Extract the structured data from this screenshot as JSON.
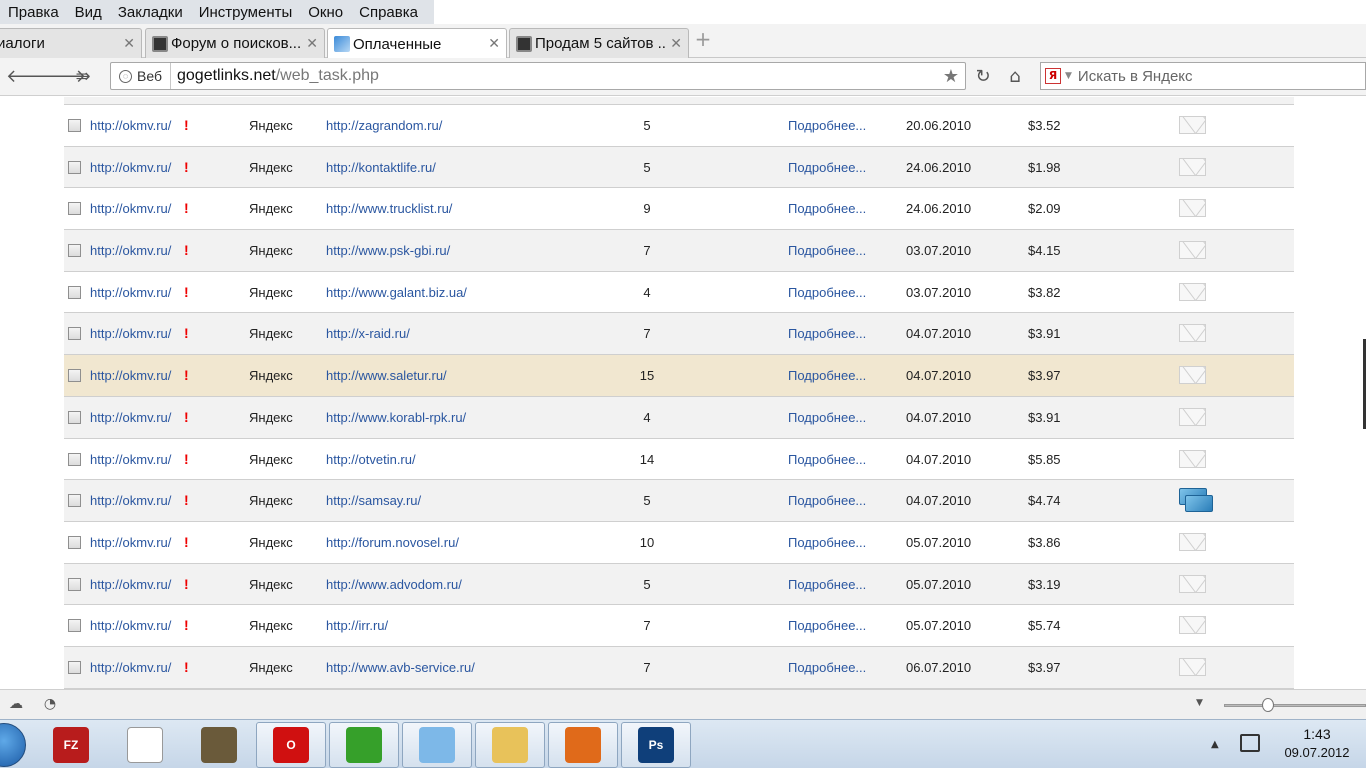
{
  "menu": [
    "Правка",
    "Вид",
    "Закладки",
    "Инструменты",
    "Окно",
    "Справка"
  ],
  "tabs": [
    {
      "title": "иалоги",
      "favicon": "none",
      "active": false
    },
    {
      "title": "Форум о поисков...",
      "favicon": "forum-icon",
      "active": false
    },
    {
      "title": "Оплаченные",
      "favicon": "chart-icon",
      "active": true
    },
    {
      "title": "Продам 5 сайтов ...",
      "favicon": "forum-icon",
      "active": false
    }
  ],
  "address": {
    "mode_label": "Веб",
    "host": "gogetlinks.net",
    "path": "/web_task.php"
  },
  "search": {
    "logo": "Я",
    "placeholder": "Искать в Яндекс"
  },
  "rows": [
    {
      "site": "http://okmv.ru/",
      "flag": "!",
      "engine": "Яндекс",
      "link": "http://zagrandom.ru/",
      "count": "5",
      "more": "Подробнее...",
      "date": "20.06.2010",
      "price": "$3.52",
      "mail": "read"
    },
    {
      "site": "http://okmv.ru/",
      "flag": "!",
      "engine": "Яндекс",
      "link": "http://kontaktlife.ru/",
      "count": "5",
      "more": "Подробнее...",
      "date": "24.06.2010",
      "price": "$1.98",
      "mail": "read"
    },
    {
      "site": "http://okmv.ru/",
      "flag": "!",
      "engine": "Яндекс",
      "link": "http://www.trucklist.ru/",
      "count": "9",
      "more": "Подробнее...",
      "date": "24.06.2010",
      "price": "$2.09",
      "mail": "read"
    },
    {
      "site": "http://okmv.ru/",
      "flag": "!",
      "engine": "Яндекс",
      "link": "http://www.psk-gbi.ru/",
      "count": "7",
      "more": "Подробнее...",
      "date": "03.07.2010",
      "price": "$4.15",
      "mail": "read"
    },
    {
      "site": "http://okmv.ru/",
      "flag": "!",
      "engine": "Яндекс",
      "link": "http://www.galant.biz.ua/",
      "count": "4",
      "more": "Подробнее...",
      "date": "03.07.2010",
      "price": "$3.82",
      "mail": "read"
    },
    {
      "site": "http://okmv.ru/",
      "flag": "!",
      "engine": "Яндекс",
      "link": "http://x-raid.ru/",
      "count": "7",
      "more": "Подробнее...",
      "date": "04.07.2010",
      "price": "$3.91",
      "mail": "read"
    },
    {
      "site": "http://okmv.ru/",
      "flag": "!",
      "engine": "Яндекс",
      "link": "http://www.saletur.ru/",
      "count": "15",
      "more": "Подробнее...",
      "date": "04.07.2010",
      "price": "$3.97",
      "mail": "read",
      "highlight": true
    },
    {
      "site": "http://okmv.ru/",
      "flag": "!",
      "engine": "Яндекс",
      "link": "http://www.korabl-rpk.ru/",
      "count": "4",
      "more": "Подробнее...",
      "date": "04.07.2010",
      "price": "$3.91",
      "mail": "read"
    },
    {
      "site": "http://okmv.ru/",
      "flag": "!",
      "engine": "Яндекс",
      "link": "http://otvetin.ru/",
      "count": "14",
      "more": "Подробнее...",
      "date": "04.07.2010",
      "price": "$5.85",
      "mail": "read"
    },
    {
      "site": "http://okmv.ru/",
      "flag": "!",
      "engine": "Яндекс",
      "link": "http://samsay.ru/",
      "count": "5",
      "more": "Подробнее...",
      "date": "04.07.2010",
      "price": "$4.74",
      "mail": "new"
    },
    {
      "site": "http://okmv.ru/",
      "flag": "!",
      "engine": "Яндекс",
      "link": "http://forum.novosel.ru/",
      "count": "10",
      "more": "Подробнее...",
      "date": "05.07.2010",
      "price": "$3.86",
      "mail": "read"
    },
    {
      "site": "http://okmv.ru/",
      "flag": "!",
      "engine": "Яндекс",
      "link": "http://www.advodom.ru/",
      "count": "5",
      "more": "Подробнее...",
      "date": "05.07.2010",
      "price": "$3.19",
      "mail": "read"
    },
    {
      "site": "http://okmv.ru/",
      "flag": "!",
      "engine": "Яндекс",
      "link": "http://irr.ru/",
      "count": "7",
      "more": "Подробнее...",
      "date": "05.07.2010",
      "price": "$5.74",
      "mail": "read"
    },
    {
      "site": "http://okmv.ru/",
      "flag": "!",
      "engine": "Яндекс",
      "link": "http://www.avb-service.ru/",
      "count": "7",
      "more": "Подробнее...",
      "date": "06.07.2010",
      "price": "$3.97",
      "mail": "read"
    }
  ],
  "taskbar": [
    {
      "name": "filezilla-icon",
      "label": "FZ",
      "color": "#b81c1c",
      "boxed": false
    },
    {
      "name": "cursor-icon",
      "label": "",
      "color": "#ffffff",
      "boxed": false
    },
    {
      "name": "screenshot-eye-icon",
      "label": "",
      "color": "#6a5a3a",
      "boxed": false
    },
    {
      "name": "opera-icon",
      "label": "O",
      "color": "#d01010",
      "boxed": true
    },
    {
      "name": "icq-flower-icon",
      "label": "",
      "color": "#36a02a",
      "boxed": true
    },
    {
      "name": "notepad-icon",
      "label": "",
      "color": "#7db8e8",
      "boxed": true
    },
    {
      "name": "explorer-folder-icon",
      "label": "",
      "color": "#e8c25a",
      "boxed": true
    },
    {
      "name": "firefox-icon",
      "label": "",
      "color": "#e06a1a",
      "boxed": true
    },
    {
      "name": "photoshop-icon",
      "label": "Ps",
      "color": "#0f3f7a",
      "boxed": true
    }
  ],
  "clock": {
    "time": "1:43",
    "date": "09.07.2012"
  },
  "colors": {
    "link": "#2a56a0",
    "flag": "#e00000",
    "highlight_row": "#f1e7d0",
    "alt_row": "#f2f2f2"
  }
}
